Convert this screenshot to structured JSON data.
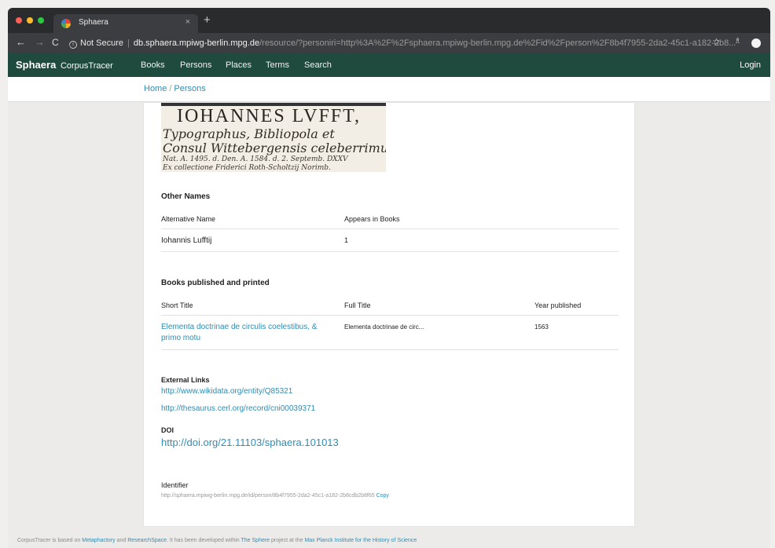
{
  "browser": {
    "tab_title": "Sphaera",
    "close_glyph": "×",
    "newtab_glyph": "+",
    "back_glyph": "←",
    "forward_glyph": "→",
    "reload_glyph": "C",
    "security_label": "Not Secure",
    "url_host": "db.sphaera.mpiwg-berlin.mpg.de",
    "url_path": "/resource/?personiri=http%3A%2F%2Fsphaera.mpiwg-berlin.mpg.de%2Fid%2Fperson%2F8b4f7955-2da2-45c1-a182-2b8...",
    "star_glyph": "☆",
    "ext_glyph": "♗"
  },
  "appnav": {
    "brand": "Sphaera",
    "brand_sub": "CorpusTracer",
    "links": [
      "Books",
      "Persons",
      "Places",
      "Terms",
      "Search"
    ],
    "login": "Login"
  },
  "breadcrumb": {
    "home": "Home",
    "separator": "/",
    "current": "Persons"
  },
  "portrait_caption": {
    "line1": "IOHANNES LVFFT,",
    "line2": "Typographus, Bibliopola et",
    "line3": "Consul Wittebergensis celeberrimus.",
    "line4": "Nat. A. 1495. d.     Den. A. 1584. d. 2. Septemb. DXXV",
    "line5": "Ex collectione Friderici Roth-Scholtzij Norimb."
  },
  "other_names": {
    "title": "Other Names",
    "headers": [
      "Alternative Name",
      "Appears in Books"
    ],
    "rows": [
      {
        "name": "Iohannis Lufftij",
        "books": "1"
      }
    ]
  },
  "books": {
    "title": "Books published and printed",
    "headers": [
      "Short Title",
      "Full Title",
      "Year published"
    ],
    "rows": [
      {
        "short_title_l1": "Elementa doctrinae de circulis coelestibus, &",
        "short_title_l2": "primo motu",
        "full_title": "Elementa doctrinae de circ...",
        "year": "1563"
      }
    ]
  },
  "external_links": {
    "title": "External Links",
    "links": [
      "http://www.wikidata.org/entity/Q85321",
      "http://thesaurus.cerl.org/record/cni00039371"
    ]
  },
  "doi": {
    "title": "DOI",
    "link": "http://doi.org/21.11103/sphaera.101013"
  },
  "identifier": {
    "title": "Identifier",
    "value": "http://sphaera.mpiwg-berlin.mpg.de/id/person/8b4f7955-2da2-45c1-a182-2b8cdb2b8f65",
    "copy": "Copy"
  },
  "footer": {
    "t1": "CorpusTracer is based on ",
    "metaphactory": "Metaphactory",
    "t2": " and ",
    "researchspace": "ResearchSpace",
    "t3": ". It has been developed within ",
    "sphere": "The Sphere",
    "t4": " project at the ",
    "mpi": "Max Planck Institute for the History of Science"
  },
  "colors": {
    "nav_bg": "#1f4a3e",
    "link": "#2f8db2",
    "chrome_dark": "#2a2b2d"
  }
}
